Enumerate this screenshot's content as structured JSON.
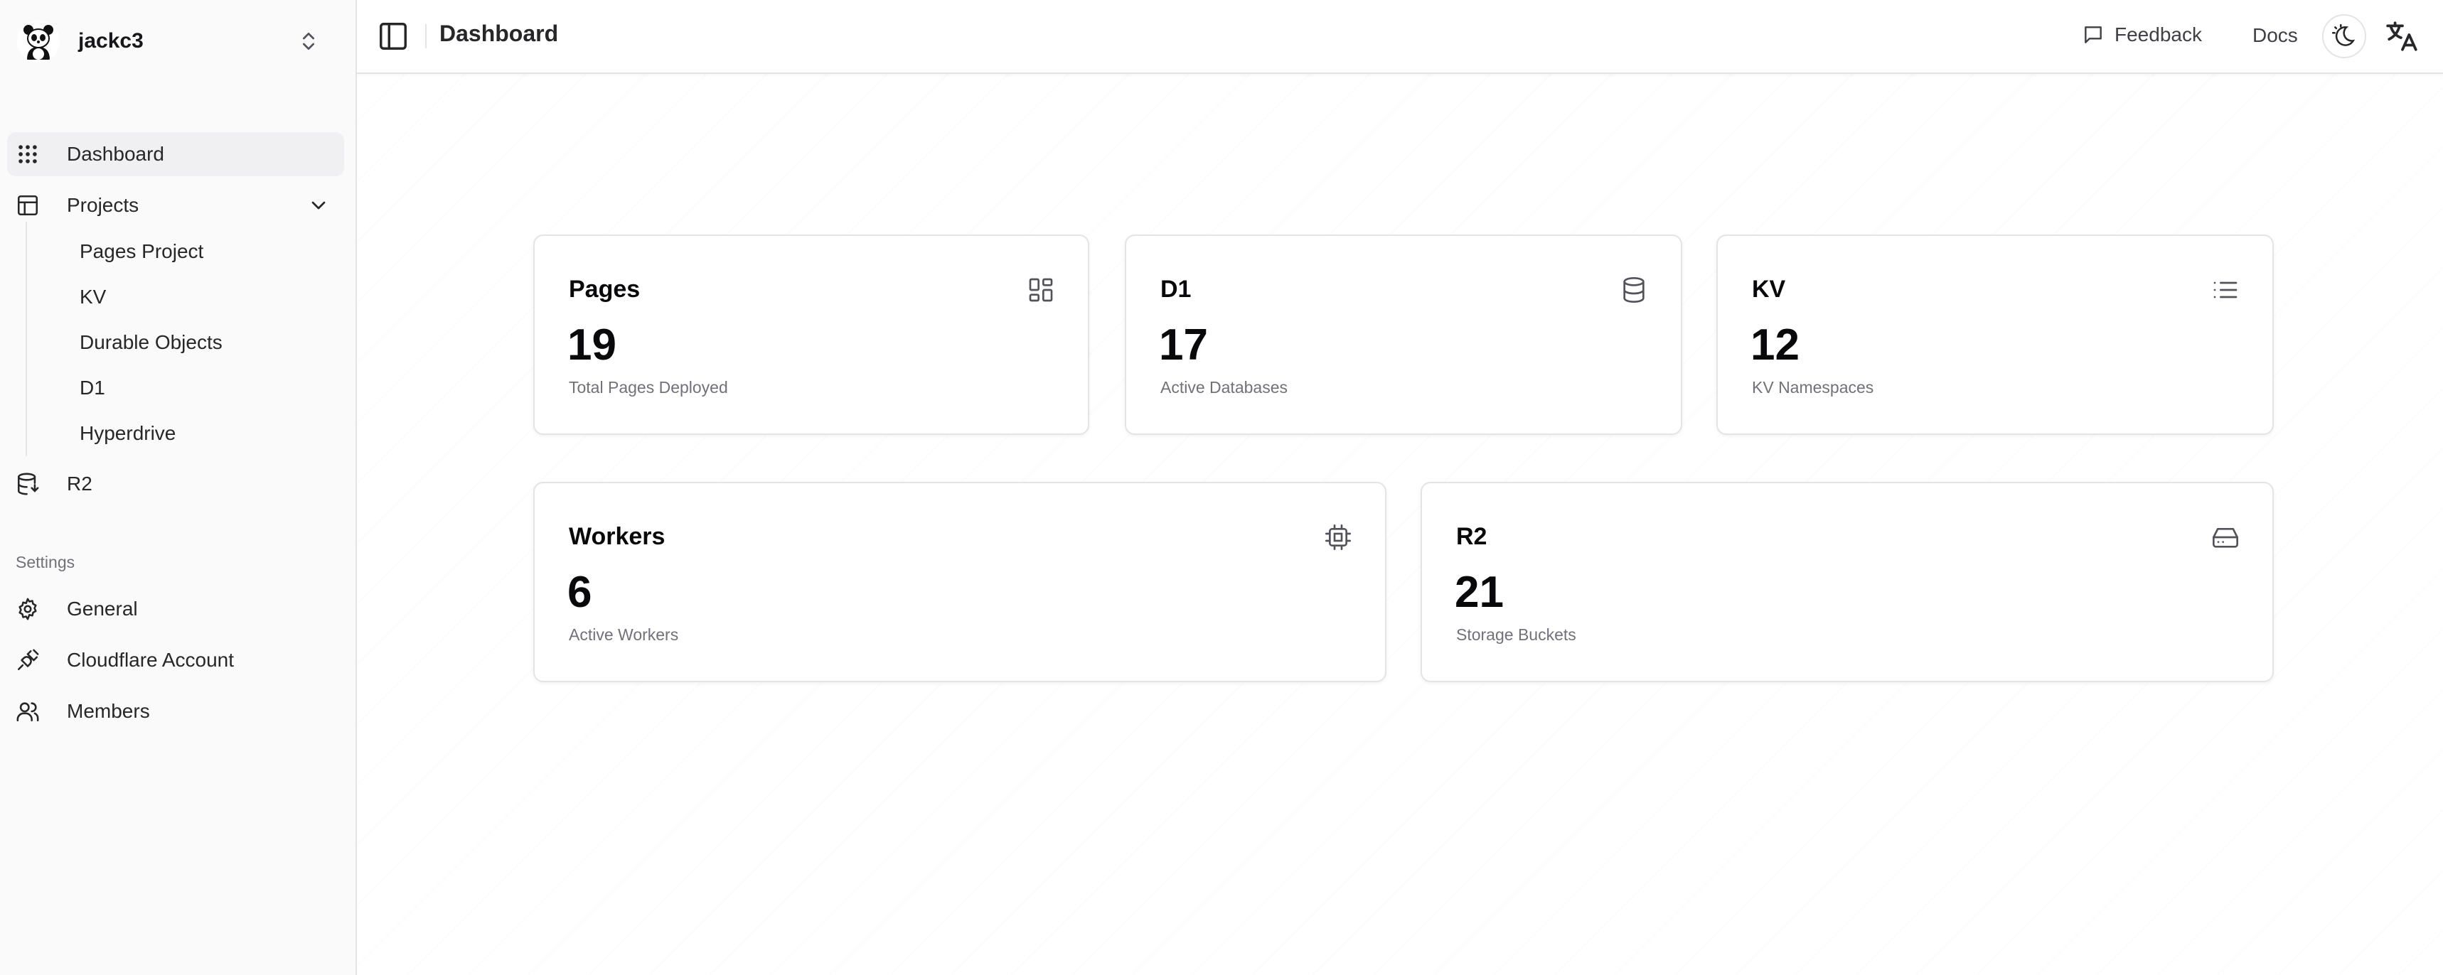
{
  "team": {
    "name": "jackc3"
  },
  "sidebar": {
    "items": [
      {
        "label": "Dashboard",
        "icon": "grid-dots-icon"
      },
      {
        "label": "Projects",
        "icon": "layout-panel-icon"
      },
      {
        "label": "R2",
        "icon": "database-icon"
      }
    ],
    "project_items": [
      {
        "label": "Pages Project"
      },
      {
        "label": "KV"
      },
      {
        "label": "Durable Objects"
      },
      {
        "label": "D1"
      },
      {
        "label": "Hyperdrive"
      }
    ],
    "settings_label": "Settings",
    "settings_items": [
      {
        "label": "General",
        "icon": "gear-icon"
      },
      {
        "label": "Cloudflare Account",
        "icon": "plug-icon"
      },
      {
        "label": "Members",
        "icon": "users-icon"
      }
    ]
  },
  "header": {
    "title": "Dashboard",
    "feedback_label": "Feedback",
    "docs_label": "Docs"
  },
  "cards": [
    {
      "title": "Pages",
      "value": "19",
      "desc": "Total Pages Deployed",
      "icon": "layout-grid-icon"
    },
    {
      "title": "D1",
      "value": "17",
      "desc": "Active Databases",
      "icon": "database-icon"
    },
    {
      "title": "KV",
      "value": "12",
      "desc": "KV Namespaces",
      "icon": "list-icon"
    },
    {
      "title": "Workers",
      "value": "6",
      "desc": "Active Workers",
      "icon": "cpu-icon"
    },
    {
      "title": "R2",
      "value": "21",
      "desc": "Storage Buckets",
      "icon": "hard-drive-icon"
    }
  ],
  "colors": {
    "accent": "#18181b",
    "muted": "#71717a",
    "border": "#e4e4e7",
    "sidebar_bg": "#fafafa"
  }
}
